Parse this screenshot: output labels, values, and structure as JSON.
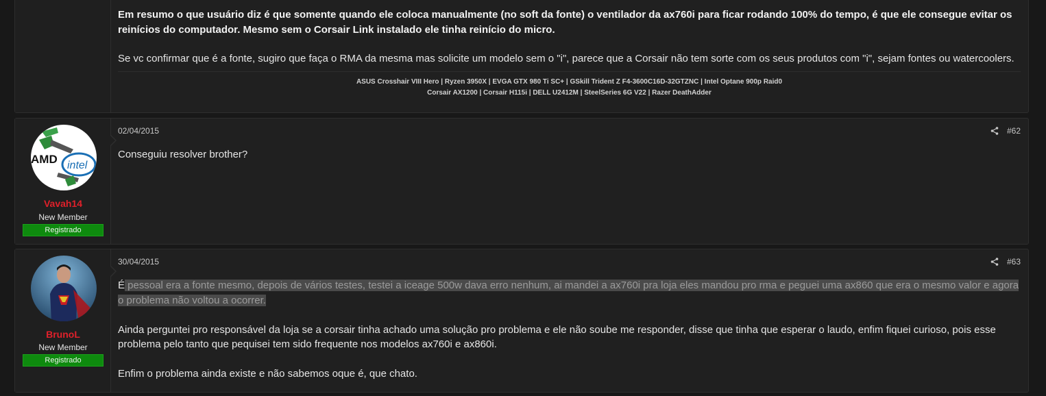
{
  "post1": {
    "bold_text": "Em resumo o que usuário diz é que somente quando ele coloca manualmente (no soft da fonte) o ventilador da ax760i para ficar rodando 100% do tempo, é que ele consegue evitar os reinícios do computador. Mesmo sem o Corsair Link instalado ele tinha reinício do micro.",
    "text": "Se vc confirmar que é a fonte, sugiro que faça o RMA da mesma mas solicite um modelo sem o \"i\", parece que a Corsair não tem sorte com os seus produtos com \"i\", sejam fontes ou watercoolers.",
    "signature_line1": "ASUS Crosshair VIII Hero | Ryzen 3950X | EVGA GTX 980 Ti SC+ | GSkill Trident Z F4-3600C16D-32GTZNC | Intel Optane 900p Raid0",
    "signature_line2": "Corsair AX1200 | Corsair H115i | DELL U2412M | SteelSeries 6G V22 | Razer DeathAdder"
  },
  "post2": {
    "username": "Vavah14",
    "user_title": "New Member",
    "badge": "Registrado",
    "date": "02/04/2015",
    "number": "#62",
    "text": "Conseguiu resolver brother?",
    "avatar_text_amd": "AMD",
    "avatar_text_intel": "intel"
  },
  "post3": {
    "username": "BrunoL",
    "user_title": "New Member",
    "badge": "Registrado",
    "date": "30/04/2015",
    "number": "#63",
    "highlight_prefix": "É",
    "highlight_text": " pessoal era a fonte mesmo, depois de vários testes, testei a iceage 500w dava erro nenhum, ai mandei a ax760i pra loja eles mandou pro rma e peguei uma ax860 que era o mesmo valor e agora o problema não voltou a ocorrer.",
    "para2": "Ainda perguntei pro responsável da loja se a corsair tinha achado uma solução pro problema e ele não soube me responder, disse que tinha que esperar o laudo, enfim fiquei curioso, pois esse problema pelo tanto que pequisei tem sido frequente nos modelos ax760i e ax860i.",
    "para3": "Enfim o problema ainda existe e não sabemos oque é, que chato."
  },
  "colors": {
    "username": "#e0202a",
    "badge": "#0e8a0e",
    "background": "#181818",
    "card": "#202020"
  }
}
